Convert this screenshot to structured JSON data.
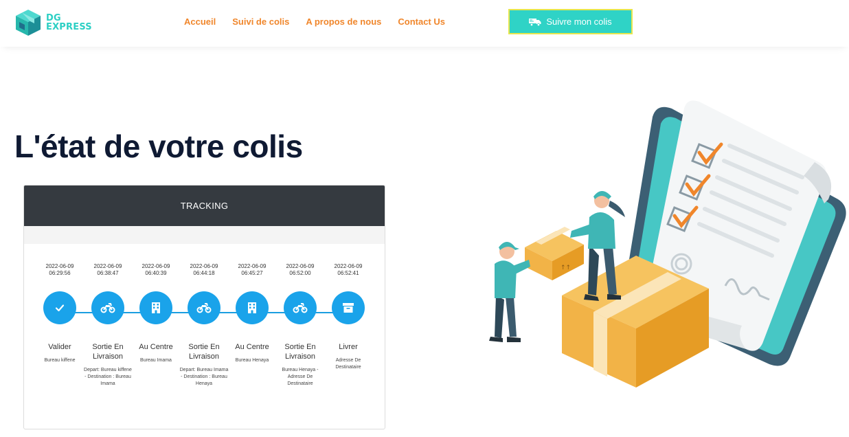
{
  "header": {
    "logo": {
      "line1": "DG",
      "line2": "EXPRESS"
    },
    "nav": [
      {
        "label": "Accueil"
      },
      {
        "label": "Suivi de colis"
      },
      {
        "label": "A propos de nous"
      },
      {
        "label": "Contact Us"
      }
    ],
    "cta_label": "Suivre mon colis"
  },
  "page_title": "L'état de votre colis",
  "tracking": {
    "header": "TRACKING",
    "steps": [
      {
        "date": "2022-06-09",
        "time": "06:29:56",
        "icon": "check-icon",
        "label": "Valider",
        "detail": "Bureau kiffene"
      },
      {
        "date": "2022-06-09",
        "time": "06:38:47",
        "icon": "motorcycle-icon",
        "label": "Sortie En Livraison",
        "detail": "Depart: Bureau kiffene - Destination : Bureau Imama"
      },
      {
        "date": "2022-06-09",
        "time": "06:40:39",
        "icon": "building-icon",
        "label": "Au Centre",
        "detail": "Bureau Imama"
      },
      {
        "date": "2022-06-09",
        "time": "06:44:18",
        "icon": "motorcycle-icon",
        "label": "Sortie En Livraison",
        "detail": "Depart: Bureau Imama - Destination : Bureau Henaya"
      },
      {
        "date": "2022-06-09",
        "time": "06:45:27",
        "icon": "building-icon",
        "label": "Au Centre",
        "detail": "Bureau Henaya"
      },
      {
        "date": "2022-06-09",
        "time": "06:52:00",
        "icon": "motorcycle-icon",
        "label": "Sortie En Livraison",
        "detail": "Bureau Henaya - Adresse De Destinataire"
      },
      {
        "date": "2022-06-09",
        "time": "06:52:41",
        "icon": "archive-icon",
        "label": "Livrer",
        "detail": "Adresse De Destinataire"
      }
    ]
  },
  "colors": {
    "accent_orange": "#f0862b",
    "cta_teal": "#2fd3c6",
    "step_blue": "#1aa3ea",
    "card_header": "#353a40",
    "title_navy": "#0f1a33"
  }
}
